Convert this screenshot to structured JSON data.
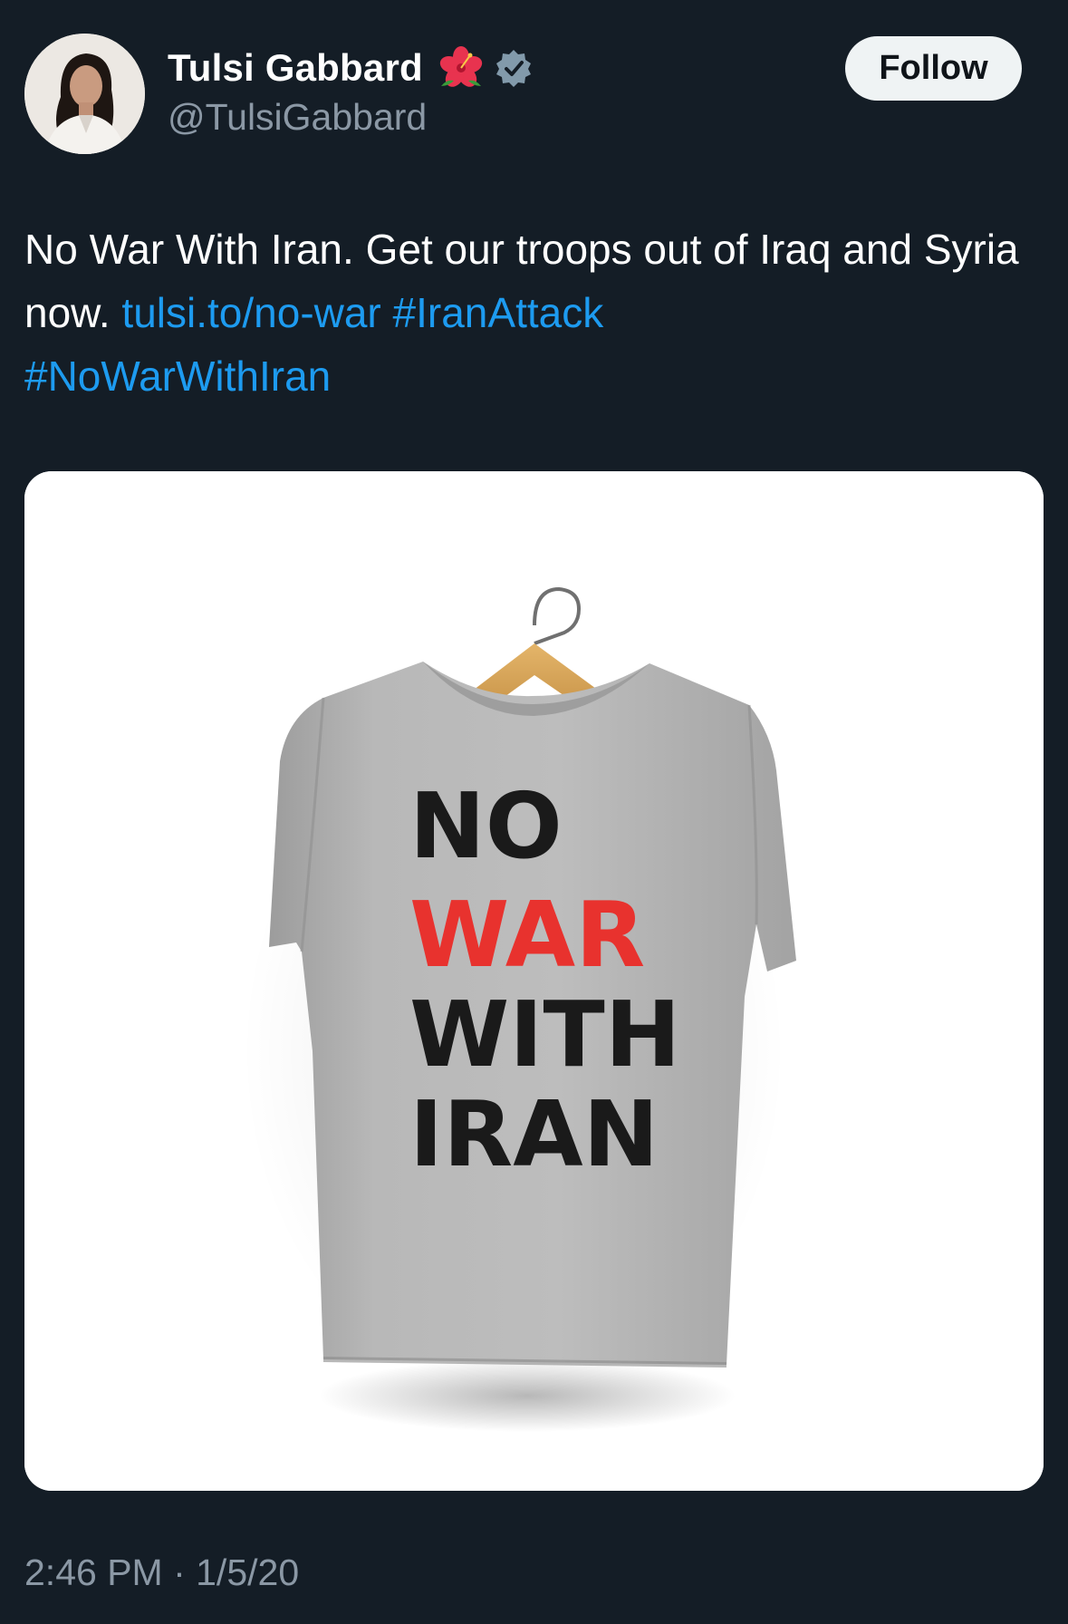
{
  "author": {
    "display_name": "Tulsi Gabbard",
    "handle": "@TulsiGabbard",
    "emoji_icon": "hibiscus-icon",
    "verified_icon": "verified-badge-icon"
  },
  "follow_label": "Follow",
  "tweet": {
    "text_plain": "No War With Iran. Get our troops out of Iraq and Syria now.",
    "link": "tulsi.to/no-war",
    "hashtag_1": "#IranAttack",
    "hashtag_2": "#NoWarWithIran"
  },
  "media": {
    "description_icon": "tshirt-photo",
    "shirt_text": {
      "line1": "NO",
      "line2": "WAR",
      "line3": "WITH",
      "line4": "IRAN"
    }
  },
  "timestamp": "2:46 PM · 1/5/20",
  "colors": {
    "background": "#141d26",
    "link": "#1d9bf0",
    "secondary_text": "#8b98a5",
    "follow_bg": "#eff3f4",
    "shirt_red": "#e8322e"
  }
}
